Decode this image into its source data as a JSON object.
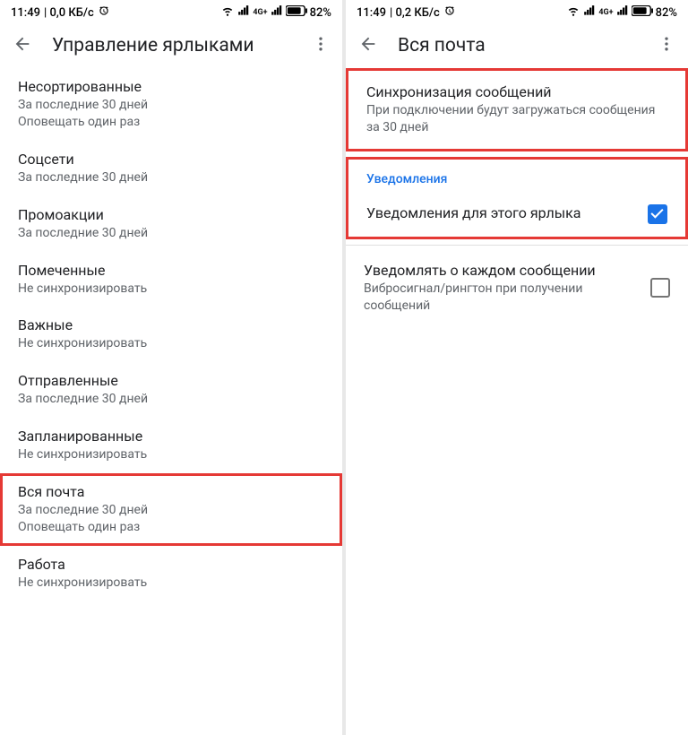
{
  "left": {
    "status": {
      "time": "11:49",
      "net_speed": "0,0 КБ/с",
      "battery": "82%"
    },
    "header_title": "Управление ярлыками",
    "items": [
      {
        "title": "Несортированные",
        "sub1": "За последние 30 дней",
        "sub2": "Оповещать один раз",
        "highlighted": false
      },
      {
        "title": "Соцсети",
        "sub1": "За последние 30 дней",
        "sub2": "",
        "highlighted": false
      },
      {
        "title": "Промоакции",
        "sub1": "За последние 30 дней",
        "sub2": "",
        "highlighted": false
      },
      {
        "title": "Помеченные",
        "sub1": "Не синхронизировать",
        "sub2": "",
        "highlighted": false
      },
      {
        "title": "Важные",
        "sub1": "Не синхронизировать",
        "sub2": "",
        "highlighted": false
      },
      {
        "title": "Отправленные",
        "sub1": "За последние 30 дней",
        "sub2": "",
        "highlighted": false
      },
      {
        "title": "Запланированные",
        "sub1": "Не синхронизировать",
        "sub2": "",
        "highlighted": false
      },
      {
        "title": "Вся почта",
        "sub1": "За последние 30 дней",
        "sub2": "Оповещать один раз",
        "highlighted": true
      },
      {
        "title": "Работа",
        "sub1": "Не синхронизировать",
        "sub2": "",
        "highlighted": false
      }
    ]
  },
  "right": {
    "status": {
      "time": "11:49",
      "net_speed": "0,2 КБ/с",
      "battery": "82%"
    },
    "header_title": "Вся почта",
    "sync": {
      "title": "Синхронизация сообщений",
      "sub": "При подключении будут загружаться сообщения за 30 дней"
    },
    "notif_section": "Уведомления",
    "notif_label": {
      "title": "Уведомления для этого ярлыка",
      "checked": true
    },
    "notif_each": {
      "title": "Уведомлять о каждом сообщении",
      "sub": "Вибросигнал/рингтон при получении сообщений",
      "checked": false
    }
  }
}
